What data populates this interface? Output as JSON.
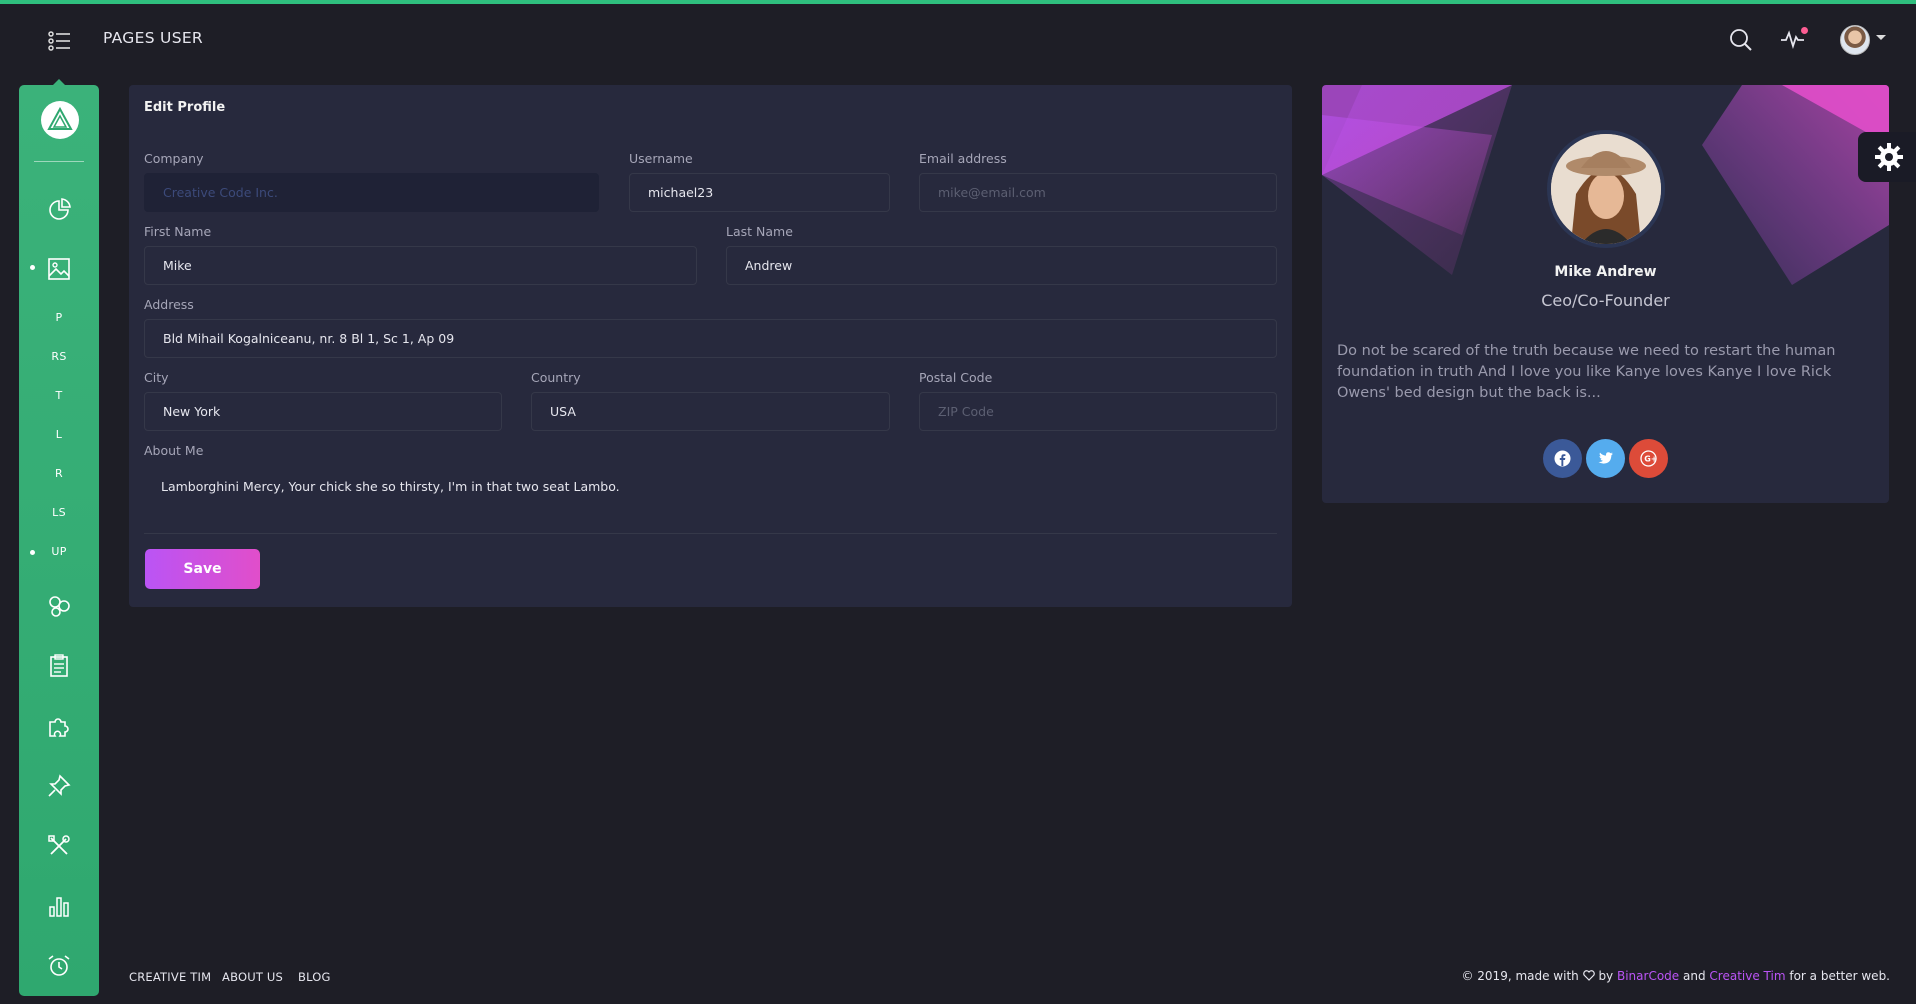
{
  "header": {
    "title": "PAGES USER"
  },
  "sidebar": {
    "items": [
      {
        "icon": "chart-pie-icon"
      },
      {
        "icon": "image-icon",
        "active": true
      },
      {
        "label": "P"
      },
      {
        "label": "RS"
      },
      {
        "label": "T"
      },
      {
        "label": "L"
      },
      {
        "label": "R"
      },
      {
        "label": "LS"
      },
      {
        "label": "UP",
        "active": true
      },
      {
        "icon": "molecule-icon"
      },
      {
        "icon": "clipboard-icon"
      },
      {
        "icon": "puzzle-icon"
      },
      {
        "icon": "pin-icon"
      },
      {
        "icon": "tools-icon"
      },
      {
        "icon": "bar-chart-icon"
      },
      {
        "icon": "alarm-clock-icon"
      }
    ]
  },
  "form": {
    "title": "Edit Profile",
    "company": {
      "label": "Company",
      "value": "Creative Code Inc."
    },
    "username": {
      "label": "Username",
      "value": "michael23"
    },
    "email": {
      "label": "Email address",
      "placeholder": "mike@email.com"
    },
    "first_name": {
      "label": "First Name",
      "value": "Mike"
    },
    "last_name": {
      "label": "Last Name",
      "value": "Andrew"
    },
    "address": {
      "label": "Address",
      "value": "Bld Mihail Kogalniceanu, nr. 8 Bl 1, Sc 1, Ap 09"
    },
    "city": {
      "label": "City",
      "value": "New York"
    },
    "country": {
      "label": "Country",
      "value": "USA"
    },
    "postal": {
      "label": "Postal Code",
      "placeholder": "ZIP Code"
    },
    "about": {
      "label": "About Me",
      "value": "Lamborghini Mercy, Your chick she so thirsty, I'm in that two seat Lambo."
    },
    "save_label": "Save"
  },
  "profile": {
    "name": "Mike Andrew",
    "role": "Ceo/Co-Founder",
    "bio": "Do not be scared of the truth because we need to restart the human foundation in truth And I love you like Kanye loves Kanye I love Rick Owens' bed design but the back is...",
    "social": [
      "facebook-icon",
      "twitter-icon",
      "google-plus-icon"
    ]
  },
  "footer": {
    "links": [
      "CREATIVE TIM",
      "ABOUT US",
      "BLOG"
    ],
    "copyright_prefix": "© 2019, made with",
    "by": "by",
    "binarcode": "BinarCode",
    "and": "and",
    "creative_tim": "Creative Tim",
    "suffix": "for a better web."
  },
  "colors": {
    "background": "#1e1e26",
    "card": "#27293d",
    "sidebar": "#3bb27a",
    "primary_gradient": [
      "#ba54f5",
      "#e14eca"
    ],
    "facebook": "#3b5998",
    "twitter": "#55acee",
    "google": "#dd4b39"
  }
}
